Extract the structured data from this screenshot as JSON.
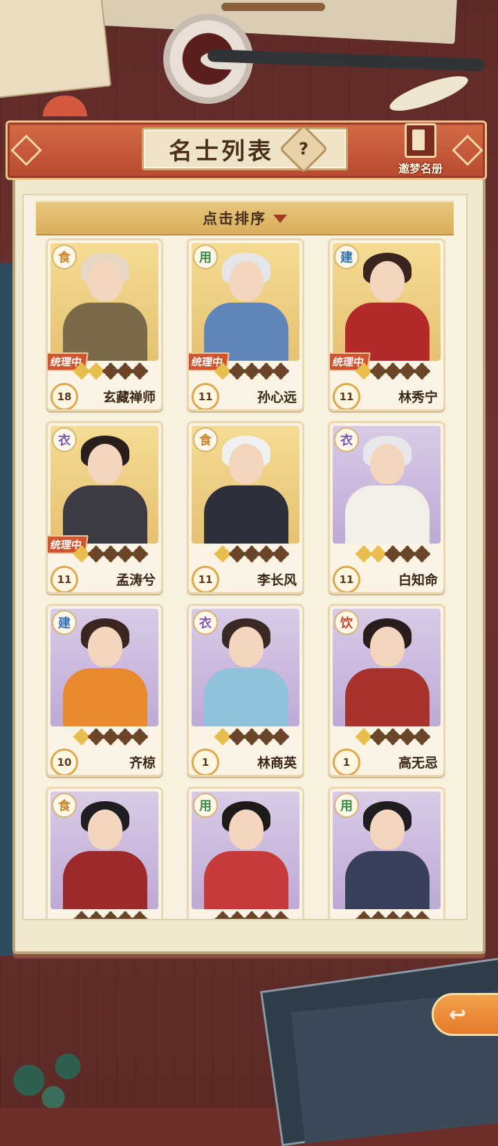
{
  "header": {
    "title": "名士列表",
    "help_glyph": "?",
    "roster_label": "邀梦名册"
  },
  "sort": {
    "label": "点击排序"
  },
  "cards": [
    {
      "type": "食",
      "type_color": "#c9852d",
      "status": "统理中",
      "stars_lit": 2,
      "stars_total": 5,
      "level": "18",
      "name": "玄藏禅师",
      "theme": "gold",
      "hair": "#e7d7c5",
      "robe": "#7a6b48"
    },
    {
      "type": "用",
      "type_color": "#3a8b4a",
      "status": "统理中",
      "stars_lit": 1,
      "stars_total": 5,
      "level": "11",
      "name": "孙心远",
      "theme": "gold",
      "hair": "#e5e6ea",
      "robe": "#5f86b8"
    },
    {
      "type": "建",
      "type_color": "#2f6fb5",
      "status": "统理中",
      "stars_lit": 1,
      "stars_total": 5,
      "level": "11",
      "name": "林秀宁",
      "theme": "gold",
      "hair": "#3a2420",
      "robe": "#b42a28"
    },
    {
      "type": "衣",
      "type_color": "#7b56b6",
      "status": "统理中",
      "stars_lit": 1,
      "stars_total": 5,
      "level": "11",
      "name": "孟涛兮",
      "theme": "gold",
      "hair": "#2a1e1c",
      "robe": "#3c3a44"
    },
    {
      "type": "食",
      "type_color": "#c9852d",
      "status": "",
      "stars_lit": 1,
      "stars_total": 5,
      "level": "11",
      "name": "李长风",
      "theme": "gold",
      "hair": "#f0f0f0",
      "robe": "#2d2f3a"
    },
    {
      "type": "衣",
      "type_color": "#7b56b6",
      "status": "",
      "stars_lit": 2,
      "stars_total": 5,
      "level": "11",
      "name": "白知命",
      "theme": "purple",
      "hair": "#e8e8ec",
      "robe": "#f2efe9"
    },
    {
      "type": "建",
      "type_color": "#2f6fb5",
      "status": "",
      "stars_lit": 1,
      "stars_total": 5,
      "level": "10",
      "name": "齐椋",
      "theme": "purple",
      "hair": "#3a2520",
      "robe": "#e8892e"
    },
    {
      "type": "衣",
      "type_color": "#7b56b6",
      "status": "",
      "stars_lit": 1,
      "stars_total": 5,
      "level": "1",
      "name": "林商英",
      "theme": "purple",
      "hair": "#3a2a26",
      "robe": "#8fc2dc"
    },
    {
      "type": "饮",
      "type_color": "#c9472d",
      "status": "",
      "stars_lit": 1,
      "stars_total": 5,
      "level": "1",
      "name": "高无忌",
      "theme": "purple",
      "hair": "#2a1e1c",
      "robe": "#a8332c"
    },
    {
      "type": "食",
      "type_color": "#c9852d",
      "status": "",
      "stars_lit": 0,
      "stars_total": 5,
      "level": "",
      "name": "",
      "theme": "purple",
      "hair": "#1e1e22",
      "robe": "#9c2a2a"
    },
    {
      "type": "用",
      "type_color": "#3a8b4a",
      "status": "",
      "stars_lit": 0,
      "stars_total": 5,
      "level": "",
      "name": "",
      "theme": "purple",
      "hair": "#1e1a1a",
      "robe": "#c63a3a"
    },
    {
      "type": "用",
      "type_color": "#3a8b4a",
      "status": "",
      "stars_lit": 0,
      "stars_total": 5,
      "level": "",
      "name": "",
      "theme": "purple",
      "hair": "#1f1d20",
      "robe": "#38405a"
    }
  ],
  "back_button": {
    "glyph": "↩"
  }
}
